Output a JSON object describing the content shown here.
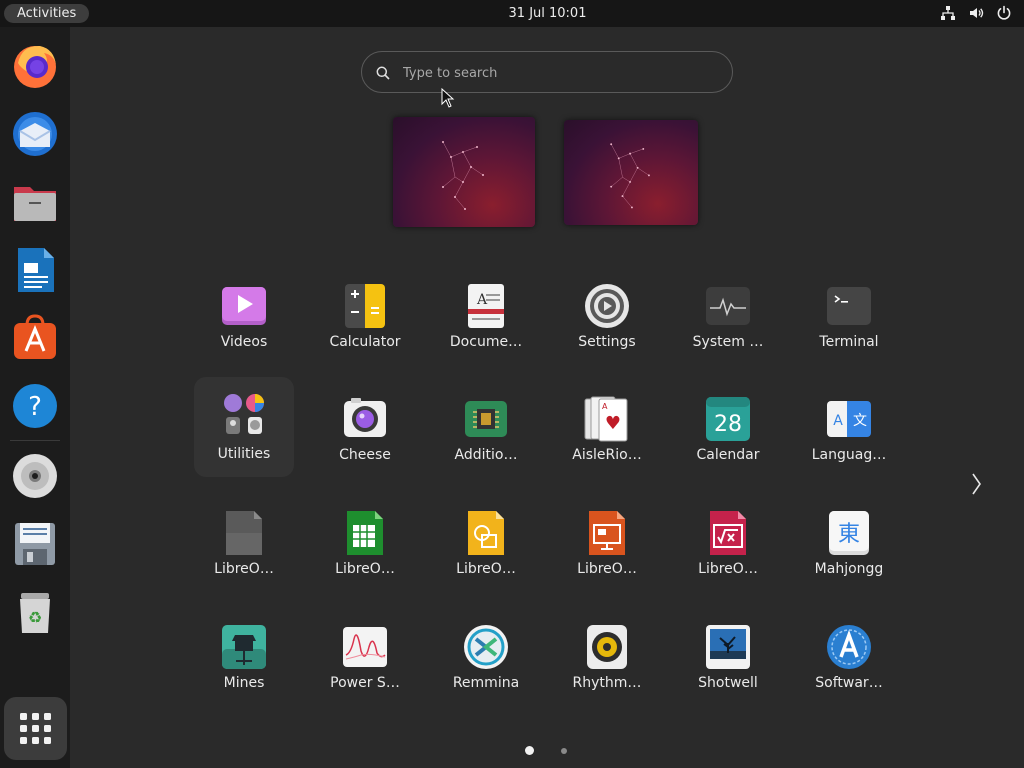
{
  "topbar": {
    "activities_label": "Activities",
    "clock": "31 Jul  10:01"
  },
  "search": {
    "placeholder": "Type to search",
    "value": ""
  },
  "dock": [
    {
      "name": "firefox",
      "label": "Firefox"
    },
    {
      "name": "thunderbird",
      "label": "Thunderbird"
    },
    {
      "name": "files",
      "label": "Files"
    },
    {
      "name": "libreoffice-writer",
      "label": "LibreOffice Writer"
    },
    {
      "name": "app-center",
      "label": "App Center"
    },
    {
      "name": "help",
      "label": "Help"
    },
    {
      "name": "disc",
      "label": "Disc"
    },
    {
      "name": "save-disk",
      "label": "Save"
    },
    {
      "name": "trash",
      "label": "Trash"
    }
  ],
  "apps": [
    {
      "label": "Videos",
      "icon": "videos-icon"
    },
    {
      "label": "Calculator",
      "icon": "calculator-icon"
    },
    {
      "label": "Docume…",
      "icon": "document-viewer-icon"
    },
    {
      "label": "Settings",
      "icon": "settings-icon"
    },
    {
      "label": "System …",
      "icon": "system-monitor-icon"
    },
    {
      "label": "Terminal",
      "icon": "terminal-icon"
    },
    {
      "label": "Utilities",
      "icon": "utilities-folder-icon"
    },
    {
      "label": "Cheese",
      "icon": "cheese-icon"
    },
    {
      "label": "Additio…",
      "icon": "additional-drivers-icon"
    },
    {
      "label": "AisleRio…",
      "icon": "aisleriot-icon"
    },
    {
      "label": "Calendar",
      "icon": "calendar-icon",
      "calendar_day": "28"
    },
    {
      "label": "Languag…",
      "icon": "language-support-icon"
    },
    {
      "label": "LibreO…",
      "icon": "libreoffice-icon"
    },
    {
      "label": "LibreO…",
      "icon": "libreoffice-calc-icon"
    },
    {
      "label": "LibreO…",
      "icon": "libreoffice-draw-icon"
    },
    {
      "label": "LibreO…",
      "icon": "libreoffice-impress-icon"
    },
    {
      "label": "LibreO…",
      "icon": "libreoffice-math-icon"
    },
    {
      "label": "Mahjongg",
      "icon": "mahjongg-icon"
    },
    {
      "label": "Mines",
      "icon": "mines-icon"
    },
    {
      "label": "Power S…",
      "icon": "power-statistics-icon"
    },
    {
      "label": "Remmina",
      "icon": "remmina-icon"
    },
    {
      "label": "Rhythm…",
      "icon": "rhythmbox-icon"
    },
    {
      "label": "Shotwell",
      "icon": "shotwell-icon"
    },
    {
      "label": "Softwar…",
      "icon": "software-updater-icon"
    }
  ],
  "pagination": {
    "current": 1,
    "total": 2
  },
  "colors": {
    "accent": "#e95420",
    "panel": "#161616",
    "background": "#2a2a2a"
  }
}
